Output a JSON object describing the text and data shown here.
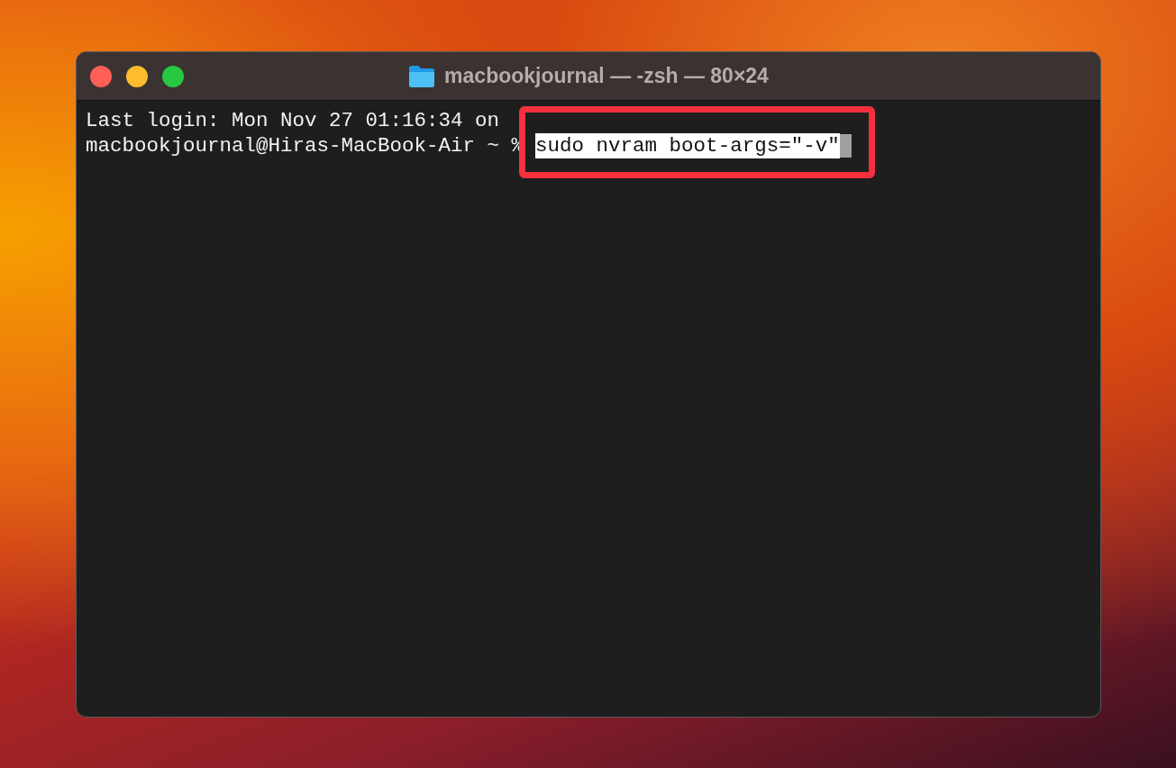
{
  "window": {
    "title": "macbookjournal — -zsh — 80×24"
  },
  "terminal": {
    "login_line": "Last login: Mon Nov 27 01:16:34 on",
    "prompt": "macbookjournal@Hiras-MacBook-Air ~ %",
    "command": {
      "text": "sudo nvram boot-args=\"-v\"",
      "selected": true
    },
    "highlight_box": true
  }
}
